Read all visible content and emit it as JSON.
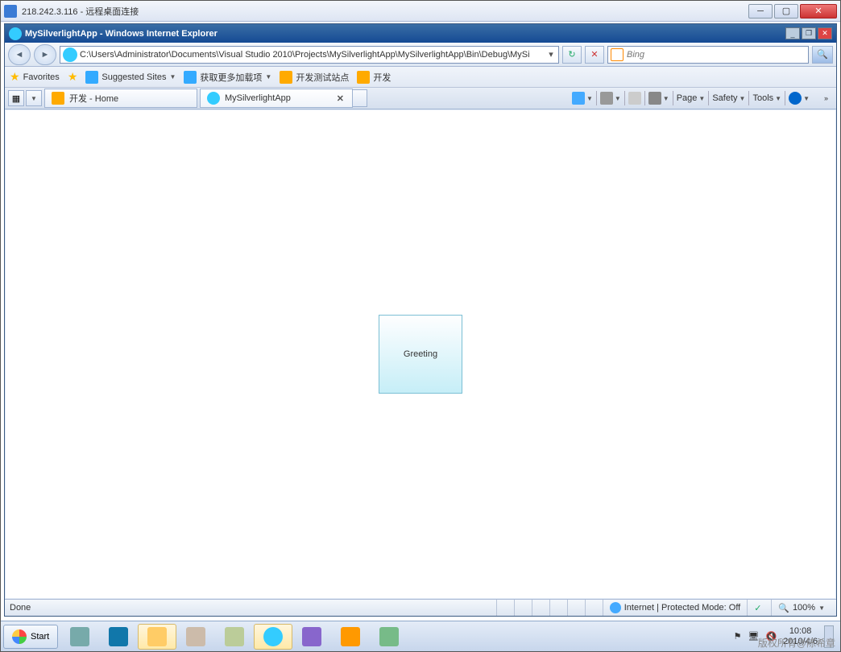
{
  "rdp": {
    "title": "218.242.3.116 - 远程桌面连接"
  },
  "ie": {
    "title": "MySilverlightApp - Windows Internet Explorer",
    "url": "C:\\Users\\Administrator\\Documents\\Visual Studio 2010\\Projects\\MySilverlightApp\\MySilverlightApp\\Bin\\Debug\\MySi",
    "search_engine": "Bing",
    "favorites": {
      "label": "Favorites",
      "suggested": "Suggested Sites",
      "more_addons": "获取更多加载项",
      "dev_site": "开发测试站点",
      "dev": "开发"
    },
    "tabs": [
      {
        "title": "开发 - Home"
      },
      {
        "title": "MySilverlightApp"
      }
    ],
    "commands": {
      "page": "Page",
      "safety": "Safety",
      "tools": "Tools"
    },
    "content": {
      "button_label": "Greeting"
    },
    "status": {
      "done": "Done",
      "zone": "Internet | Protected Mode: Off",
      "zoom": "100%"
    }
  },
  "taskbar": {
    "start": "Start",
    "time": "10:08",
    "date": "2010/4/6"
  },
  "watermark": "版权所有@陈希章"
}
